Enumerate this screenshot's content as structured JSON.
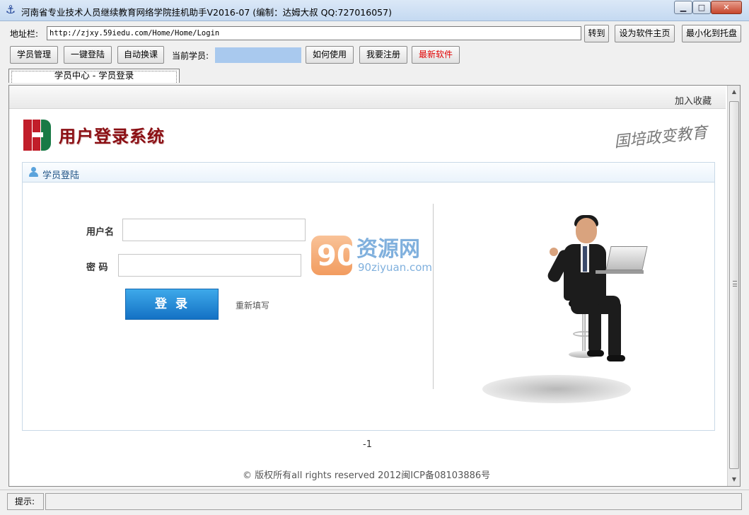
{
  "window": {
    "title": "河南省专业技术人员继续教育网络学院挂机助手V2016-07 (编制：达姆大叔 QQ:727016057)",
    "controls": {
      "minimize": "▁",
      "maximize": "□",
      "close": "✕"
    }
  },
  "toolbar1": {
    "address_label": "地址栏:",
    "address_value": "http://zjxy.59iedu.com/Home/Home/Login",
    "go_button": "转到",
    "set_home_button": "设为软件主页",
    "minimize_tray_button": "最小化到托盘"
  },
  "toolbar2": {
    "student_manage": "学员管理",
    "one_click_login": "一键登陆",
    "auto_switch": "自动换课",
    "current_student_label": "当前学员:",
    "current_student_value": "",
    "how_to_use": "如何使用",
    "register": "我要注册",
    "latest_software": "最新软件"
  },
  "tab": {
    "label": "学员中心 - 学员登录"
  },
  "page": {
    "add_favorite": "加入收藏",
    "system_title": "用户登录系统",
    "slogan": "国培政变教育",
    "panel_title": "学员登陆",
    "username_label": "用户名",
    "password_label": "密 码",
    "username_value": "",
    "password_value": "",
    "login_button": "登录",
    "reset_link": "重新填写",
    "watermark_text": "资源网",
    "watermark_logo": "90",
    "watermark_sub": "90ziyuan.com",
    "page_number": "-1",
    "footer": "© 版权所有all rights reserved 2012闽ICP备08103886号"
  },
  "statusbar": {
    "label": "提示:",
    "value": ""
  },
  "colors": {
    "accent_blue": "#1471c4",
    "brand_red": "#8b0f14",
    "latest_software_red": "#e00000"
  }
}
